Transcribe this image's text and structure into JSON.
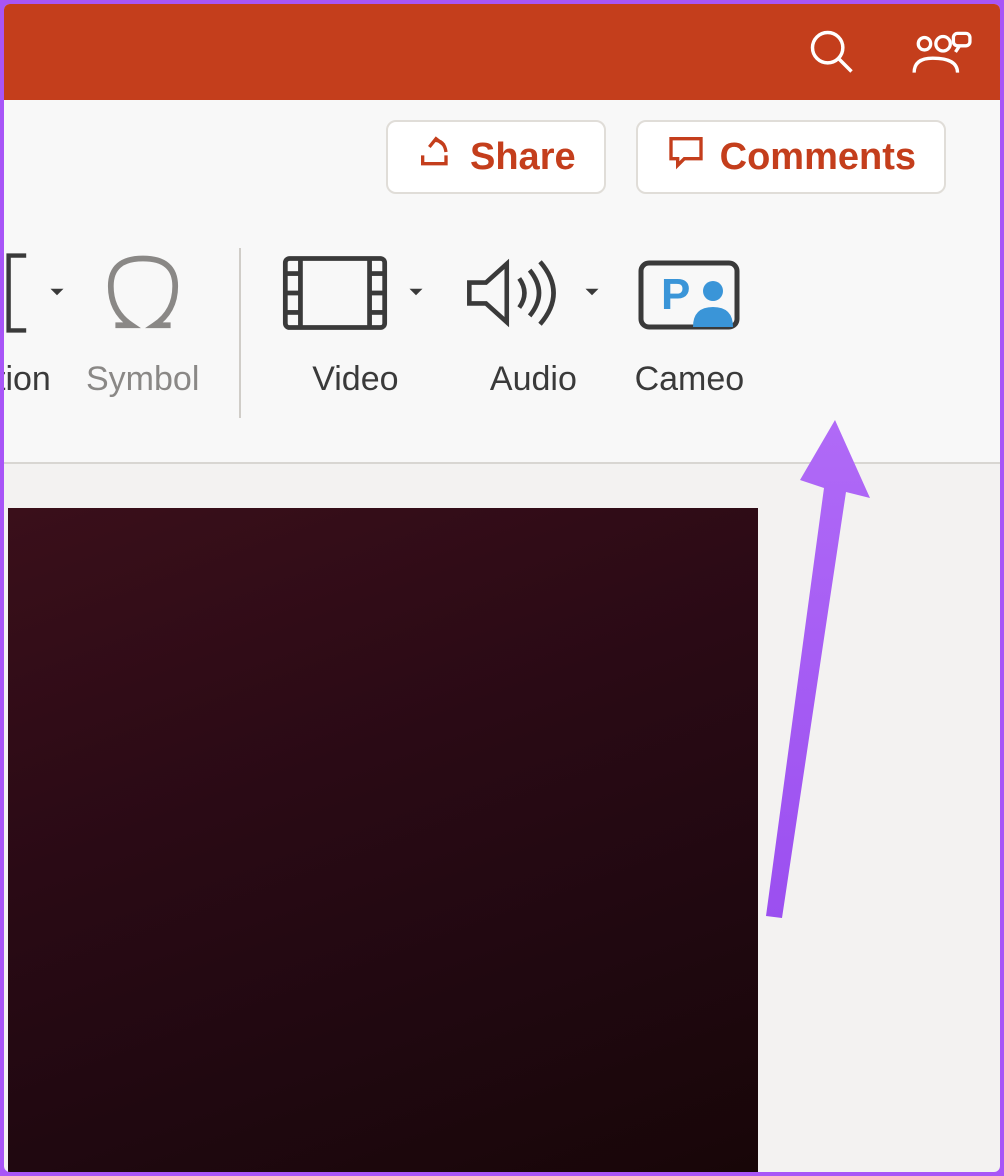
{
  "actions": {
    "share": "Share",
    "comments": "Comments"
  },
  "ribbon": {
    "partial_label": "tion",
    "symbol": "Symbol",
    "video": "Video",
    "audio": "Audio",
    "cameo": "Cameo",
    "cameo_badge": "P"
  },
  "colors": {
    "accent": "#c43e1c",
    "annotation": "#a855f7"
  }
}
